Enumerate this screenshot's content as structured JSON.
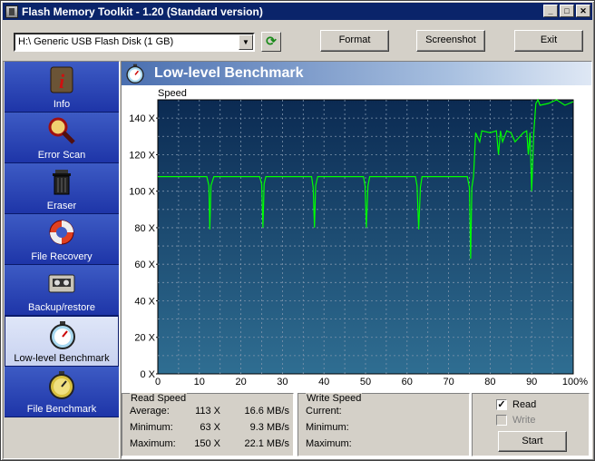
{
  "window": {
    "title": "Flash Memory Toolkit - 1.20 (Standard version)",
    "min": "_",
    "max": "□",
    "close": "✕"
  },
  "toolbar": {
    "drive": "H:\\ Generic USB Flash Disk (1 GB)",
    "format_label": "Format",
    "screenshot_label": "Screenshot",
    "exit_label": "Exit"
  },
  "sidebar": {
    "items": [
      {
        "label": "Info",
        "icon": "info-icon"
      },
      {
        "label": "Error Scan",
        "icon": "magnifier-icon"
      },
      {
        "label": "Eraser",
        "icon": "trash-icon"
      },
      {
        "label": "File Recovery",
        "icon": "lifebuoy-icon"
      },
      {
        "label": "Backup/restore",
        "icon": "tape-icon"
      },
      {
        "label": "Low-level Benchmark",
        "icon": "stopwatch-icon",
        "active": true
      },
      {
        "label": "File Benchmark",
        "icon": "stopwatch-icon"
      }
    ]
  },
  "header": {
    "title": "Low-level Benchmark"
  },
  "chart_data": {
    "type": "line",
    "ylabel": "Speed",
    "xlabel": "",
    "xlim": [
      0,
      100
    ],
    "ylim": [
      0,
      150
    ],
    "x_ticks": [
      "0",
      "10",
      "20",
      "30",
      "40",
      "50",
      "60",
      "70",
      "80",
      "90",
      "100%"
    ],
    "y_ticks": [
      "0 X",
      "20 X",
      "40 X",
      "60 X",
      "80 X",
      "100 X",
      "120 X",
      "140 X"
    ],
    "series": [
      {
        "color": "#00ff00",
        "x": [
          0,
          11.8,
          12.3,
          12.5,
          12.8,
          13.5,
          24.5,
          25,
          25.3,
          25.6,
          26,
          37,
          37.4,
          37.7,
          38,
          38.5,
          49.5,
          49.9,
          50.2,
          50.6,
          51,
          62,
          62.4,
          62.8,
          63.2,
          63.6,
          74.5,
          75,
          75.3,
          75.6,
          76,
          76.5,
          77.5,
          78,
          80,
          81.5,
          82,
          82.5,
          83,
          84,
          85,
          86,
          88,
          88.8,
          89.2,
          89.6,
          90,
          90.5,
          91,
          91.5,
          92,
          94,
          96,
          98,
          100
        ],
        "y": [
          108,
          108,
          103,
          79,
          103,
          108,
          108,
          104,
          80,
          104,
          108,
          108,
          102,
          80,
          103,
          108,
          108,
          103,
          80,
          103,
          108,
          108,
          103,
          79,
          102,
          108,
          108,
          102,
          63,
          102,
          108,
          132,
          127,
          133,
          132,
          133,
          120,
          133,
          127,
          133,
          132,
          127,
          132,
          133,
          120,
          132,
          100,
          132,
          148,
          150,
          147,
          148,
          150,
          147,
          149
        ]
      }
    ]
  },
  "read_speed": {
    "title": "Read Speed",
    "rows": [
      {
        "label": "Average:",
        "x": "113 X",
        "mbs": "16.6 MB/s"
      },
      {
        "label": "Minimum:",
        "x": "63 X",
        "mbs": "9.3 MB/s"
      },
      {
        "label": "Maximum:",
        "x": "150 X",
        "mbs": "22.1 MB/s"
      }
    ]
  },
  "write_speed": {
    "title": "Write Speed",
    "rows": [
      {
        "label": "Current:"
      },
      {
        "label": "Minimum:"
      },
      {
        "label": "Maximum:"
      }
    ]
  },
  "options": {
    "read_label": "Read",
    "read_checked": true,
    "write_label": "Write",
    "write_checked": false,
    "start_label": "Start"
  }
}
